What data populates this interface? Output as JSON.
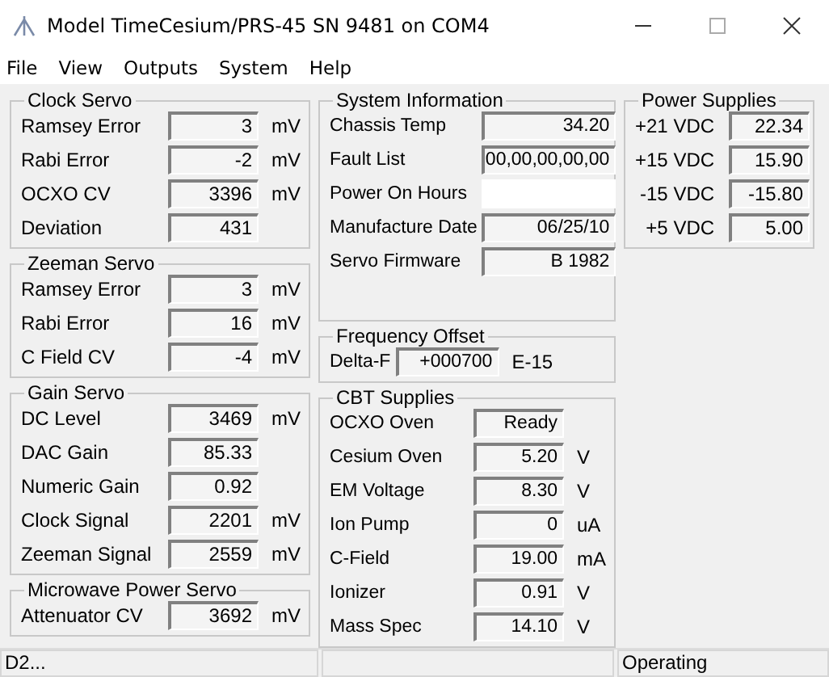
{
  "window": {
    "title": "Model TimeCesium/PRS-45 SN 9481 on COM4"
  },
  "menu": [
    "File",
    "View",
    "Outputs",
    "System",
    "Help"
  ],
  "columns": [
    [
      {
        "title": "Clock Servo",
        "kind": "units",
        "rows": [
          {
            "label": "Ramsey Error",
            "value": "3",
            "unit": "mV"
          },
          {
            "label": "Rabi Error",
            "value": "-2",
            "unit": "mV"
          },
          {
            "label": "OCXO CV",
            "value": "3396",
            "unit": "mV"
          },
          {
            "label": "Deviation",
            "value": "431"
          }
        ]
      },
      {
        "title": "Zeeman Servo",
        "kind": "units",
        "rows": [
          {
            "label": "Ramsey Error",
            "value": "3",
            "unit": "mV"
          },
          {
            "label": "Rabi Error",
            "value": "16",
            "unit": "mV"
          },
          {
            "label": "C Field CV",
            "value": "-4",
            "unit": "mV"
          }
        ]
      },
      {
        "title": "Gain Servo",
        "kind": "units",
        "rows": [
          {
            "label": "DC Level",
            "value": "3469",
            "unit": "mV"
          },
          {
            "label": "DAC Gain",
            "value": "85.33"
          },
          {
            "label": "Numeric Gain",
            "value": "0.92"
          },
          {
            "label": "Clock Signal",
            "value": "2201",
            "unit": "mV"
          },
          {
            "label": "Zeeman Signal",
            "value": "2559",
            "unit": "mV"
          }
        ]
      },
      {
        "title": "Microwave Power Servo",
        "kind": "units",
        "rows": [
          {
            "label": "Attenuator CV",
            "value": "3692",
            "unit": "mV"
          }
        ]
      }
    ],
    [
      {
        "title": "System Information",
        "kind": "wide",
        "rows": [
          {
            "label": "Chassis Temp",
            "value": "34.20"
          },
          {
            "label": "Fault List",
            "value": "00,00,00,00,00"
          },
          {
            "label": "Power On Hours",
            "kind": "blank"
          },
          {
            "label": "Manufacture Date",
            "value": "06/25/10"
          },
          {
            "label": "Servo Firmware",
            "value": "B 1982"
          }
        ]
      },
      {
        "title": "Frequency Offset",
        "kind": "inline",
        "rows": [
          {
            "label": "Delta-F",
            "value": "+000700",
            "unit": "E-15"
          }
        ]
      },
      {
        "title": "CBT Supplies",
        "kind": "units",
        "rows": [
          {
            "label": "OCXO Oven",
            "value": "Ready"
          },
          {
            "label": "Cesium Oven",
            "value": "5.20",
            "unit": "V"
          },
          {
            "label": "EM Voltage",
            "value": "8.30",
            "unit": "V"
          },
          {
            "label": "Ion Pump",
            "value": "0",
            "unit": "uA"
          },
          {
            "label": "C-Field",
            "value": "19.00",
            "unit": "mA"
          },
          {
            "label": "Ionizer",
            "value": "0.91",
            "unit": "V"
          },
          {
            "label": "Mass Spec",
            "value": "14.10",
            "unit": "V"
          }
        ]
      }
    ],
    [
      {
        "title": "Power Supplies",
        "kind": "right",
        "rows": [
          {
            "label": "+21 VDC",
            "value": "22.34"
          },
          {
            "label": "+15 VDC",
            "value": "15.90"
          },
          {
            "label": "-15 VDC",
            "value": "-15.80"
          },
          {
            "label": "+5 VDC",
            "value": "5.00"
          }
        ]
      }
    ]
  ],
  "status_bar": [
    "D2...",
    "Operating"
  ]
}
